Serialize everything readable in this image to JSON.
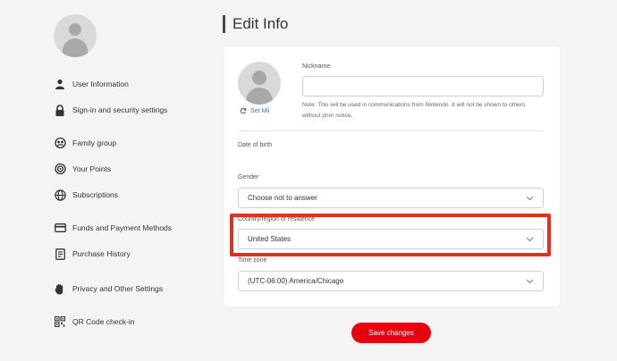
{
  "sidebar": {
    "items": [
      {
        "label": "User Information",
        "icon": "user-icon"
      },
      {
        "label": "Sign-in and security settings",
        "icon": "lock-icon"
      },
      {
        "label": "Family group",
        "icon": "family-icon"
      },
      {
        "label": "Your Points",
        "icon": "points-icon"
      },
      {
        "label": "Subscriptions",
        "icon": "globe-icon"
      },
      {
        "label": "Funds and Payment Methods",
        "icon": "card-icon"
      },
      {
        "label": "Purchase History",
        "icon": "receipt-icon"
      },
      {
        "label": "Privacy and Other Settings",
        "icon": "hand-icon"
      },
      {
        "label": "QR Code check-in",
        "icon": "qr-icon"
      }
    ]
  },
  "main": {
    "title": "Edit Info",
    "set_mii_label": "Set Mii",
    "nickname": {
      "label": "Nickname",
      "value": "",
      "note": "Note: This will be used in communications from Nintendo. It will not be shown to others without prior notice."
    },
    "dob_label": "Date of birth",
    "gender": {
      "label": "Gender",
      "value": "Choose not to answer"
    },
    "country": {
      "label": "Country/region of residence",
      "value": "United States"
    },
    "timezone": {
      "label": "Time zone",
      "value": "(UTC-06:00) America/Chicago"
    },
    "save_label": "Save changes"
  },
  "colors": {
    "accent": "#e60012",
    "highlight_border": "#e0301e",
    "link": "#3a72b8"
  }
}
